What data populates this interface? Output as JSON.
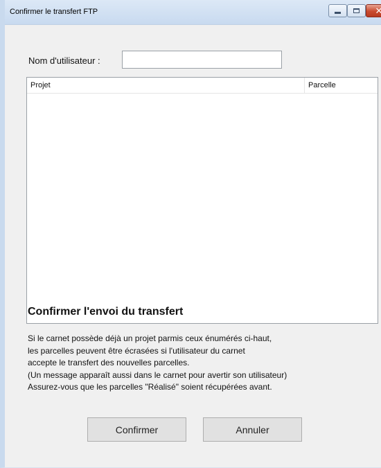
{
  "window": {
    "title": "Confirmer le transfert FTP",
    "controls": {
      "minimize_icon": "minimize-icon",
      "maximize_icon": "maximize-icon",
      "close_icon": "close-icon",
      "close_glyph": "✕"
    }
  },
  "form": {
    "username_label": "Nom d'utilisateur :",
    "username_value": "",
    "list": {
      "columns": [
        "Projet",
        "Parcelle"
      ],
      "rows": []
    },
    "heading": "Confirmer l'envoi du transfert",
    "message_lines": [
      "Si le carnet possède déjà un projet parmis ceux énumérés ci-haut,",
      "les parcelles peuvent être écrasées si l'utilisateur du carnet",
      "accepte le transfert des nouvelles parcelles.",
      "(Un message apparaît aussi dans le carnet pour avertir son utilisateur)",
      "Assurez-vous que les parcelles \"Réalisé\" soient récupérées avant."
    ]
  },
  "buttons": {
    "confirm": "Confirmer",
    "cancel": "Annuler"
  },
  "colors": {
    "titlebar": "#c8daf0",
    "client_bg": "#f0f0f0",
    "close_button": "#c94a2f"
  }
}
